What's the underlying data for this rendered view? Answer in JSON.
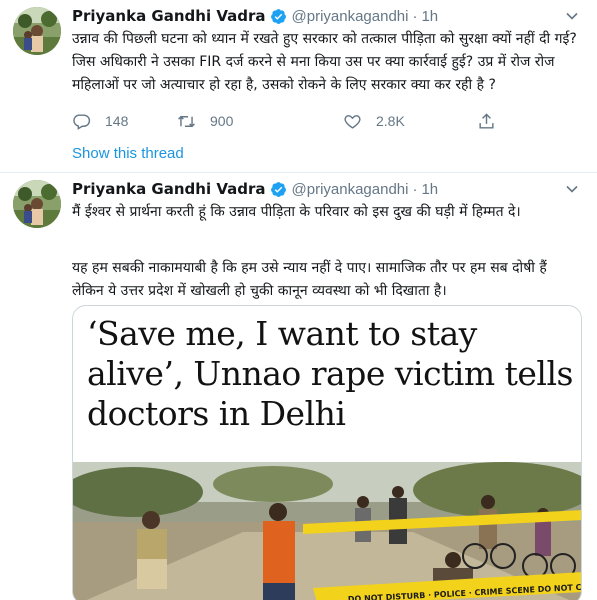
{
  "tweets": [
    {
      "author": {
        "name": "Priyanka Gandhi Vadra",
        "handle": "@priyankagandhi",
        "separator": "·",
        "time": "1h"
      },
      "text": "उन्नाव की पिछली घटना को ध्यान में रखते हुए सरकार को तत्काल पीड़िता को सुरक्षा क्यों नहीं दी गई? जिस अधिकारी ने उसका FIR दर्ज करने से मना किया उस पर क्या कार्रवाई हुई? उप्र में रोज रोज महिलाओं पर जो अत्याचार हो रहा है, उसको रोकने के लिए सरकार क्या कर रही है ?",
      "actions": {
        "replies": "148",
        "retweets": "900",
        "likes": "2.8K"
      },
      "show_thread": "Show this thread"
    },
    {
      "author": {
        "name": "Priyanka Gandhi Vadra",
        "handle": "@priyankagandhi",
        "separator": "·",
        "time": "1h"
      },
      "text_p1": "मैं ईश्वर से प्रार्थना करती हूं कि उन्नाव पीड़िता के परिवार को इस दुख की घड़ी में हिम्मत दे।",
      "text_p2": "यह हम सबकी नाकामयाबी है कि हम उसे न्याय नहीं दे पाए। सामाजिक तौर पर हम सब दोषी हैं लेकिन ये उत्तर प्रदेश में खोखली हो चुकी कानून व्यवस्था को भी दिखाता है।",
      "card": {
        "headline": "‘Save me, I want to stay alive’, Unnao rape victim tells doctors in Delhi",
        "tape_text": "DO NOT DISTURB · POLICE · CRIME SCENE DO NOT CROSS"
      }
    }
  ],
  "colors": {
    "text": "#14171a",
    "secondary": "#657786",
    "link": "#1b95e0",
    "verified": "#1da1f2",
    "border": "#e6ecf0"
  },
  "icons": [
    "verified-badge-icon",
    "chevron-down-icon",
    "reply-icon",
    "retweet-icon",
    "like-icon",
    "share-icon"
  ]
}
